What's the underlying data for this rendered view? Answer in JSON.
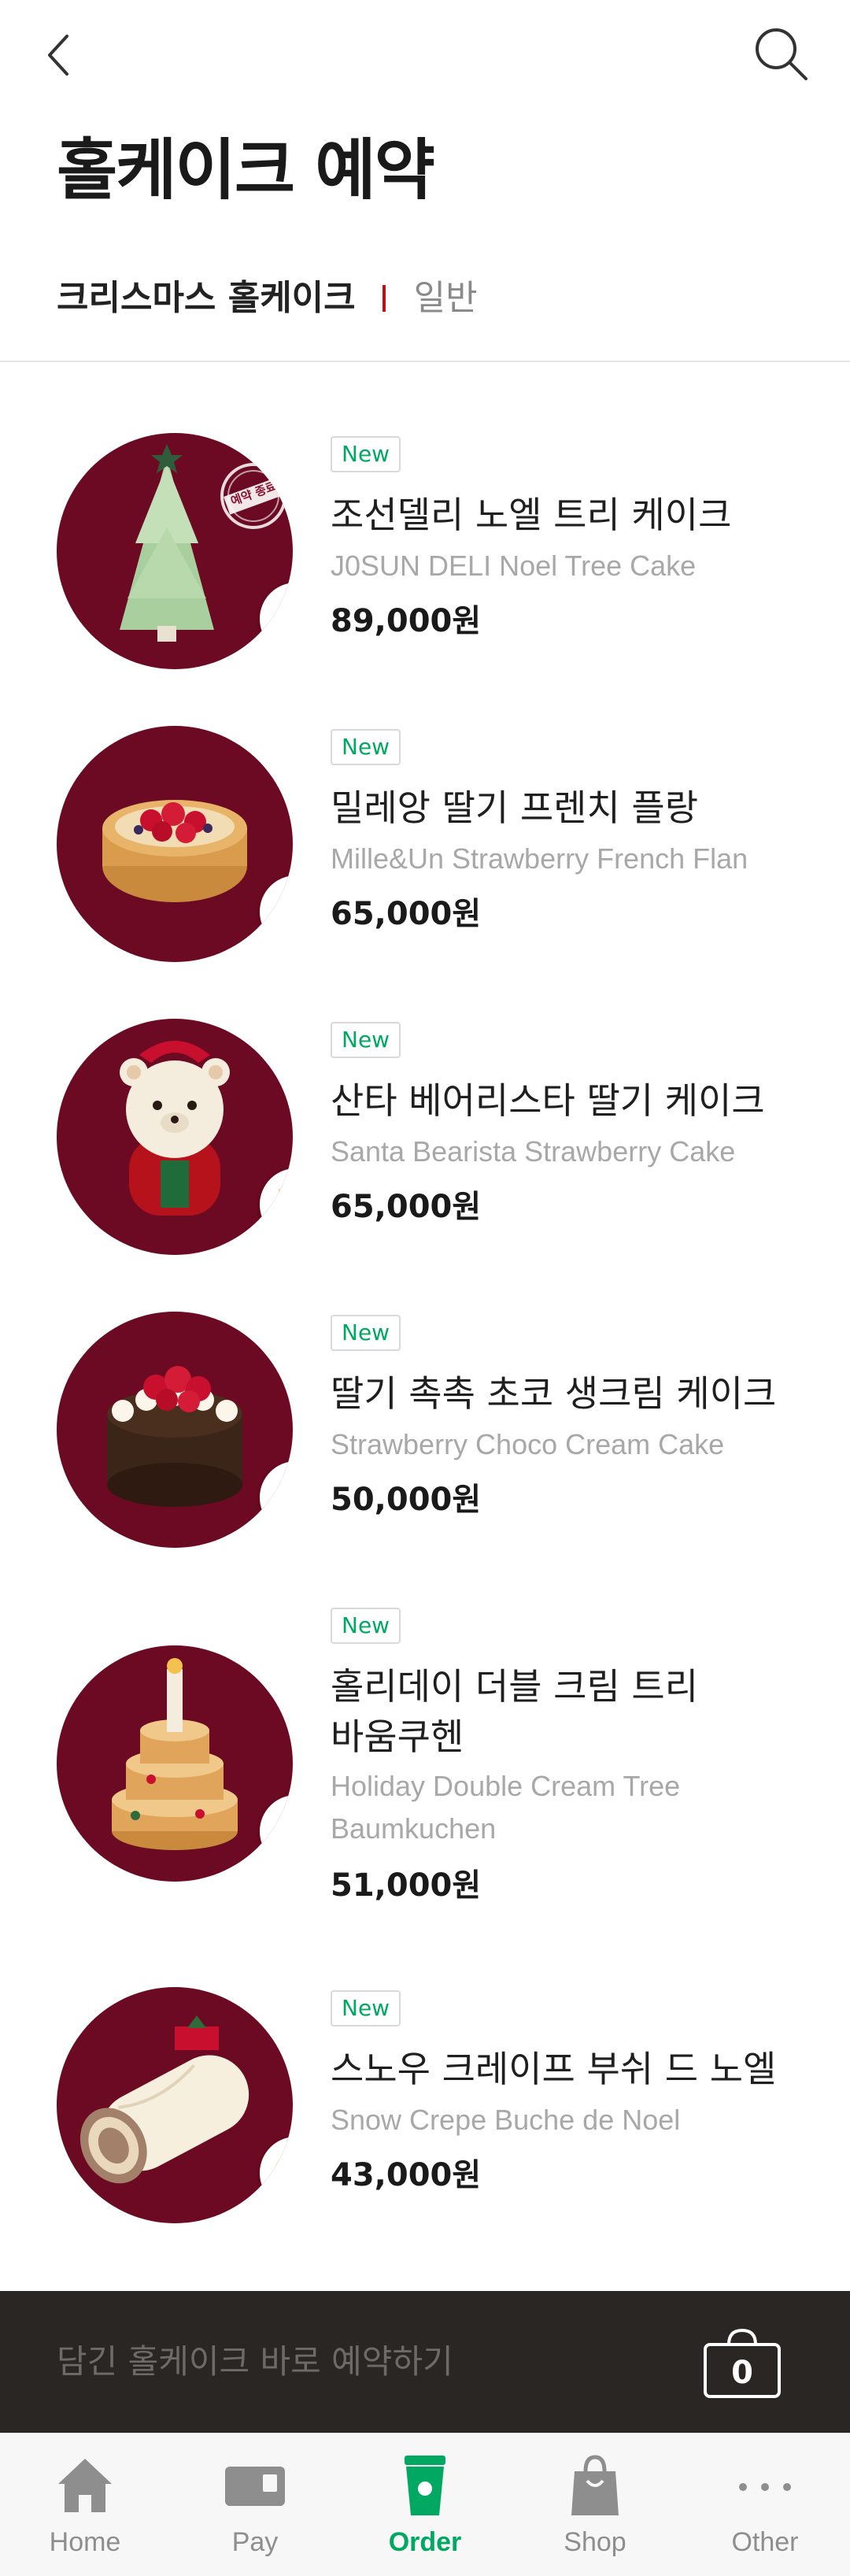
{
  "header": {
    "title": "홀케이크 예약"
  },
  "tabs": [
    {
      "label": "크리스마스 홀케이크",
      "active": true
    },
    {
      "label": "일반",
      "active": false
    }
  ],
  "products": [
    {
      "badge": "New",
      "name": "조선델리 노엘 트리 케이크",
      "name_line2": "",
      "eng": "J0SUN DELI Noel Tree Cake",
      "eng_line2": "",
      "price": "89,000원",
      "stamp": "예약 종료"
    },
    {
      "badge": "New",
      "name": "밀레앙 딸기 프렌치 플랑",
      "name_line2": "",
      "eng": "Mille&Un Strawberry French Flan",
      "eng_line2": "",
      "price": "65,000원"
    },
    {
      "badge": "New",
      "name": "산타 베어리스타 딸기 케이크",
      "name_line2": "",
      "eng": "Santa Bearista Strawberry Cake",
      "eng_line2": "",
      "price": "65,000원"
    },
    {
      "badge": "New",
      "name": "딸기 촉촉 초코 생크림 케이크",
      "name_line2": "",
      "eng": "Strawberry Choco Cream Cake",
      "eng_line2": "",
      "price": "50,000원"
    },
    {
      "badge": "New",
      "name": "홀리데이 더블 크림 트리",
      "name_line2": "바움쿠헨",
      "eng": "Holiday Double Cream Tree",
      "eng_line2": "Baumkuchen",
      "price": "51,000원"
    },
    {
      "badge": "New",
      "name": "스노우 크레이프 부쉬 드 노엘",
      "name_line2": "",
      "eng": "Snow Crepe Buche de Noel",
      "eng_line2": "",
      "price": "43,000원"
    }
  ],
  "cart": {
    "label": "담긴 홀케이크 바로 예약하기",
    "count": "0"
  },
  "nav": [
    {
      "label": "Home",
      "icon": "home-icon",
      "active": false
    },
    {
      "label": "Pay",
      "icon": "pay-card-icon",
      "active": false
    },
    {
      "label": "Order",
      "icon": "order-cup-icon",
      "active": true
    },
    {
      "label": "Shop",
      "icon": "shopping-bag-icon",
      "active": false
    },
    {
      "label": "Other",
      "icon": "more-dots-icon",
      "active": false
    }
  ],
  "colors": {
    "accent": "#00a862",
    "thumb_bg": "#6b0a22",
    "tab_separator": "#b5121b",
    "cart_bar": "#2a2624"
  }
}
